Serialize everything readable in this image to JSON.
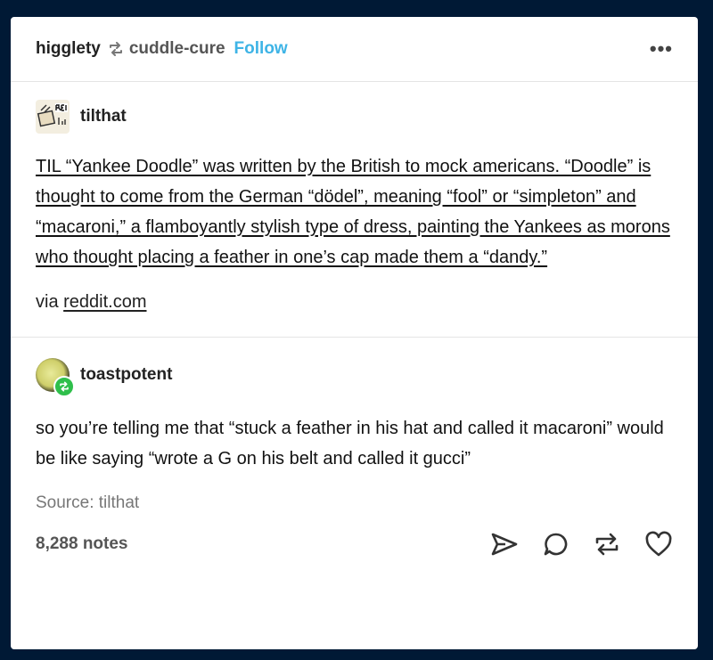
{
  "header": {
    "username": "higglety",
    "reblogged_from": "cuddle-cure",
    "follow_label": "Follow",
    "more_label": "•••"
  },
  "original_post": {
    "author": "tilthat",
    "body": "TIL “Yankee Doodle” was written by the British to mock americans. “Doodle” is thought to come from the German “dödel”, meaning “fool” or “simpleton” and “macaroni,” a flamboyantly stylish type of dress, painting the Yankees as morons who thought placing a feather in one’s cap made them a “dandy.”",
    "via_prefix": "via ",
    "via_link": "reddit.com"
  },
  "reblog": {
    "author": "toastpotent",
    "body": "so you’re telling me that “stuck a feather in his hat and called it macaroni” would be like saying “wrote a G on his belt and called it gucci”"
  },
  "source": "Source: tilthat",
  "footer": {
    "notes": "8,288 notes"
  }
}
